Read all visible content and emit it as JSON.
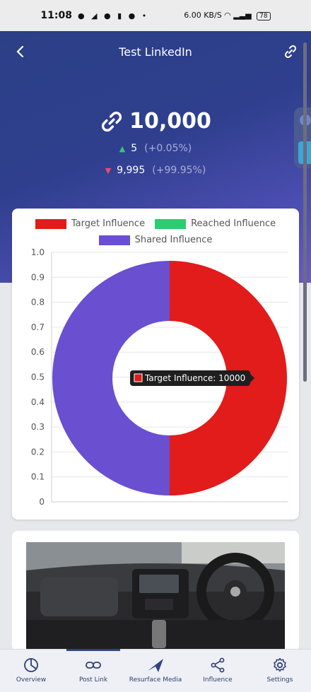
{
  "status_bar": {
    "time": "11:08",
    "app_icons": "● ◢ ● ▮ ● •",
    "network": "6.00 KB/S",
    "battery": "78"
  },
  "header": {
    "title": "Test LinkedIn",
    "count": "10,000",
    "up_value": "5",
    "up_change": "(+0.05%)",
    "down_value": "9,995",
    "down_change": "(+99.95%)"
  },
  "chart_data": {
    "type": "pie",
    "legend": [
      "Target Influence",
      "Reached Influence",
      "Shared Influence"
    ],
    "series": [
      {
        "name": "Target Influence",
        "value": 10000,
        "color": "#e21b1b"
      },
      {
        "name": "Reached Influence",
        "value": 0,
        "color": "#2ecc71"
      },
      {
        "name": "Shared Influence",
        "value": 10000,
        "color": "#6a4fd0"
      }
    ],
    "y_ticks": [
      "1.0",
      "0.9",
      "0.8",
      "0.7",
      "0.6",
      "0.5",
      "0.4",
      "0.3",
      "0.2",
      "0.1",
      "0"
    ],
    "tooltip": "Target Influence: 10000",
    "grid": true,
    "legend_position": "top"
  },
  "nav": [
    {
      "label": "Overview",
      "icon": "pie-chart-icon"
    },
    {
      "label": "Post Link",
      "icon": "link-icon"
    },
    {
      "label": "Resurface Media",
      "icon": "paper-plane-icon"
    },
    {
      "label": "Influence",
      "icon": "share-icon"
    },
    {
      "label": "Settings",
      "icon": "gear-icon"
    }
  ],
  "colors": {
    "header_start": "#2b3f86",
    "header_end": "#6a5bc6",
    "accent_nav": "#2c3e74",
    "up": "#2ecc71",
    "down": "#e84b73"
  }
}
